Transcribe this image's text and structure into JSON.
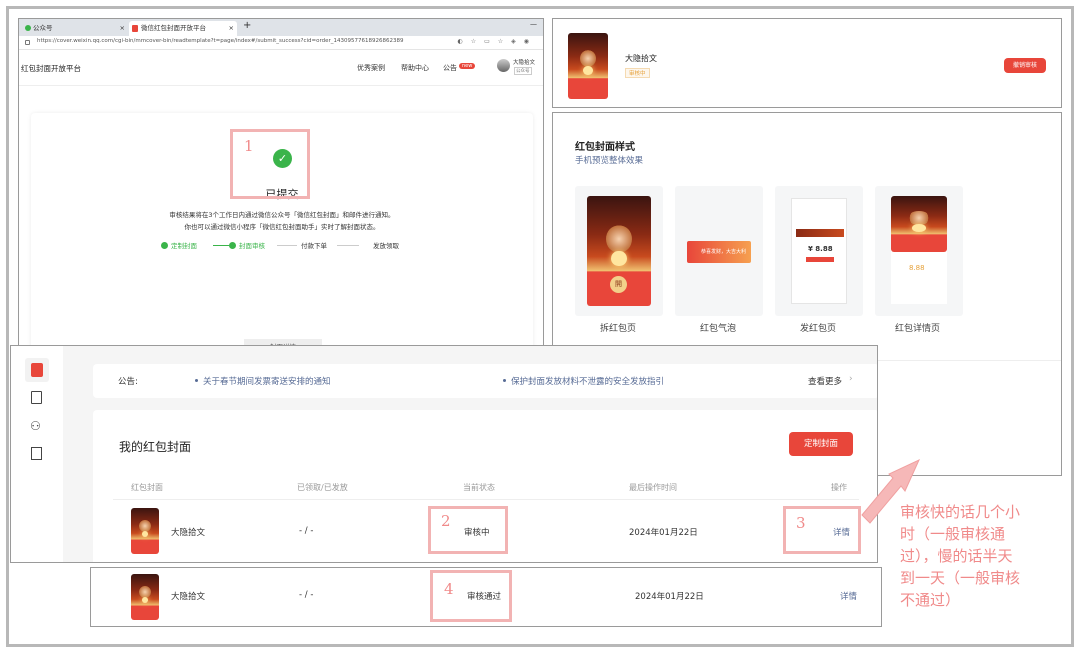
{
  "browser": {
    "tab1": "公众号",
    "tab2": "微信红包封面开放平台",
    "close": "×",
    "plus": "+",
    "minimize": "—",
    "url": "https://cover.weixin.qq.com/cgi-bin/mmcover-bin/readtemplate?t=page/index#/submit_success?cid=order_14309577618926862389"
  },
  "platform_header": {
    "title": "红包封面开放平台",
    "nav": [
      "优秀案例",
      "帮助中心",
      "公告"
    ],
    "nav_badge": "new",
    "account_name": "大隐拾文",
    "account_type": "公众号"
  },
  "submit_page": {
    "marker": "1",
    "status": "已提交",
    "desc_line1": "审核结果将在3个工作日内通过微信公众号「微信红包封面」和邮件进行通知。",
    "desc_line2": "你也可以通过微信小程序「微信红包封面助手」实时了解封面状态。",
    "steps": [
      "定制封面",
      "封面审核",
      "付款下单",
      "发放领取"
    ],
    "detail_button": "封面详情"
  },
  "review_card": {
    "name": "大隐拾文",
    "badge": "审核中",
    "button": "撤销审核"
  },
  "styles_card": {
    "title": "红包封面样式",
    "subtitle": "手机预览整体效果",
    "items": [
      "拆红包页",
      "红包气泡",
      "发红包页",
      "红包详情页"
    ],
    "bubble_text": "恭喜发财，大吉大利",
    "amount": "¥ 8.88",
    "amount2": "8.88",
    "open_char": "開"
  },
  "dashboard": {
    "notice_label": "公告:",
    "notices": [
      "关于春节期间发票寄送安排的通知",
      "保护封面发放材料不泄露的安全发放指引"
    ],
    "more": "查看更多",
    "section_title": "我的红包封面",
    "custom_button": "定制封面",
    "columns": [
      "红包封面",
      "已领取/已发放",
      "当前状态",
      "最后操作时间",
      "操作"
    ],
    "rows": [
      {
        "name": "大隐拾文",
        "count": "- / -",
        "status": "审核中",
        "time": "2024年01月22日",
        "action": "详情",
        "status_marker": "2",
        "action_marker": "3"
      },
      {
        "name": "大隐拾文",
        "count": "- / -",
        "status": "审核通过",
        "time": "2024年01月22日",
        "action": "详情",
        "status_marker": "4"
      }
    ]
  },
  "annotation": {
    "text_lines": [
      "审核快的话几个小",
      "时（一般审核通",
      "过），慢的话半天",
      "到一天（一般审核",
      "不通过）"
    ]
  },
  "colors": {
    "accent": "#e8463a",
    "link": "#576b95",
    "success": "#3ab44a",
    "annotation": "#f08a8a"
  }
}
